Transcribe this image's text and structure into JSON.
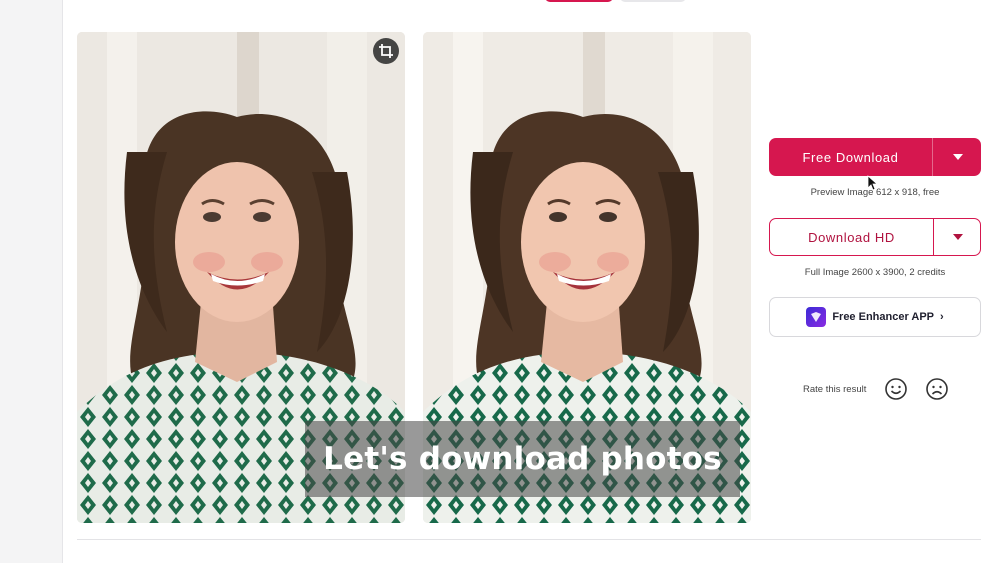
{
  "caption": "Let's download photos",
  "actions": {
    "free_download": {
      "label": "Free Download",
      "note": "Preview Image 612 x 918, free"
    },
    "download_hd": {
      "label": "Download HD",
      "note": "Full Image 2600 x 3900, 2 credits"
    },
    "app": {
      "label": "Free Enhancer APP",
      "chevron": "›"
    }
  },
  "rating": {
    "label": "Rate this result",
    "icons": [
      "smile-icon",
      "frown-icon"
    ]
  },
  "icons": {
    "crop": "crop-icon",
    "dropdown": "caret-down-icon",
    "app_logo": "enhancer-app-logo"
  },
  "colors": {
    "accent": "#d6174f",
    "background": "#ffffff"
  }
}
